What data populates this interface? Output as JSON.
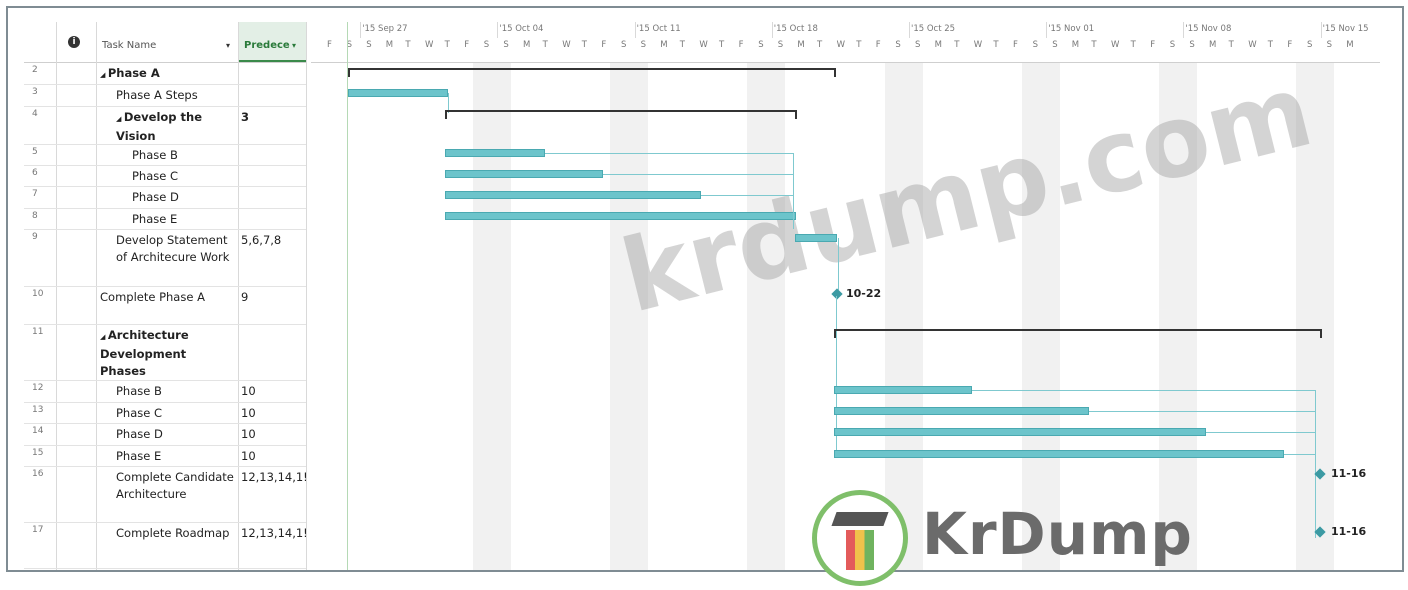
{
  "columns": {
    "info_icon": "info-icon",
    "task_name": "Task Name",
    "predecessors": "Predece"
  },
  "timescale": {
    "weeks": [
      "'15 Sep 27",
      "'15 Oct 04",
      "'15 Oct 11",
      "'15 Oct 18",
      "'15 Oct 25",
      "'15 Nov 01",
      "'15 Nov 08",
      "'15 Nov 15"
    ],
    "days": [
      "F",
      "S",
      "S",
      "M",
      "T",
      "W",
      "T",
      "F",
      "S",
      "S",
      "M",
      "T",
      "W",
      "T",
      "F",
      "S",
      "S",
      "M",
      "T",
      "W",
      "T",
      "F",
      "S",
      "S",
      "M",
      "T",
      "W",
      "T",
      "F",
      "S",
      "S",
      "M",
      "T",
      "W",
      "T",
      "F",
      "S",
      "S",
      "M",
      "T",
      "W",
      "T",
      "F",
      "S",
      "S",
      "M",
      "T",
      "W",
      "T",
      "F",
      "S",
      "S",
      "M"
    ]
  },
  "rows": [
    {
      "num": "2",
      "name": "Phase A",
      "pred": "",
      "bold": true,
      "indent": 0,
      "summary": true
    },
    {
      "num": "3",
      "name": "Phase A Steps",
      "pred": "",
      "bold": false,
      "indent": 1
    },
    {
      "num": "4",
      "name": "Develop the Vision",
      "pred": "3",
      "bold": true,
      "indent": 1,
      "summary": true
    },
    {
      "num": "5",
      "name": "Phase B",
      "pred": "",
      "bold": false,
      "indent": 2
    },
    {
      "num": "6",
      "name": "Phase C",
      "pred": "",
      "bold": false,
      "indent": 2
    },
    {
      "num": "7",
      "name": "Phase D",
      "pred": "",
      "bold": false,
      "indent": 2
    },
    {
      "num": "8",
      "name": "Phase E",
      "pred": "",
      "bold": false,
      "indent": 2
    },
    {
      "num": "9",
      "name": "Develop Statement of Architecure Work",
      "pred": "5,6,7,8",
      "bold": false,
      "indent": 1
    },
    {
      "num": "10",
      "name": "Complete Phase A",
      "pred": "9",
      "bold": false,
      "indent": 0
    },
    {
      "num": "11",
      "name": "Architecture Development Phases",
      "pred": "",
      "bold": true,
      "indent": 0,
      "summary": true
    },
    {
      "num": "12",
      "name": "Phase B",
      "pred": "10",
      "bold": false,
      "indent": 1
    },
    {
      "num": "13",
      "name": "Phase C",
      "pred": "10",
      "bold": false,
      "indent": 1
    },
    {
      "num": "14",
      "name": "Phase D",
      "pred": "10",
      "bold": false,
      "indent": 1
    },
    {
      "num": "15",
      "name": "Phase E",
      "pred": "10",
      "bold": false,
      "indent": 1
    },
    {
      "num": "16",
      "name": "Complete Candidate Architecture",
      "pred": "12,13,14,1!",
      "bold": false,
      "indent": 1
    },
    {
      "num": "17",
      "name": "Complete Roadmap",
      "pred": "12,13,14,1!",
      "bold": false,
      "indent": 1
    }
  ],
  "milestones": {
    "complete_phase_a": "10-22",
    "complete_candidate": "11-16",
    "complete_roadmap": "11-16"
  },
  "watermark": "krdump.com",
  "logo_text": "KrDump",
  "colors": {
    "bar": "#6cc4cb",
    "summary": "#333333",
    "link": "#7fc9cf",
    "logo_ring": "#7fbf6a"
  }
}
